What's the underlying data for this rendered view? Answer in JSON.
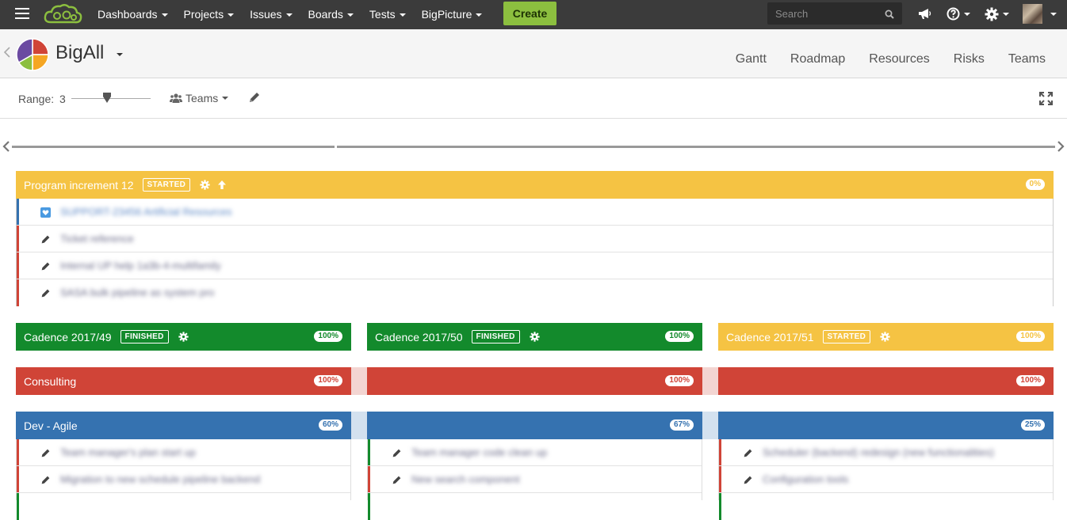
{
  "topnav": {
    "menus": [
      "Dashboards",
      "Projects",
      "Issues",
      "Boards",
      "Tests",
      "BigPicture"
    ],
    "create_label": "Create",
    "search_placeholder": "Search"
  },
  "project": {
    "name": "BigAll",
    "tabs": [
      "Gantt",
      "Roadmap",
      "Resources",
      "Risks",
      "Teams"
    ]
  },
  "toolbar": {
    "range_label": "Range:",
    "range_value": "3",
    "range_level": 0.45,
    "teams_label": "Teams"
  },
  "program_increment": {
    "title": "Program increment 12",
    "status": "STARTED",
    "percent": "0%",
    "color": "#f5c343",
    "issues": [
      {
        "text": "SUPPORT-23456 Artificial Resources",
        "bar_color": "#3572b0",
        "icon": "heart-issue-icon"
      },
      {
        "text": "Ticket reference",
        "bar_color": "#d04437",
        "icon": "pencil-icon"
      },
      {
        "text": "Internal UP help 1a3b-4-multifamily",
        "bar_color": "#d04437",
        "icon": "pencil-icon"
      },
      {
        "text": "SASA bulk pipeline as system pro",
        "bar_color": "#d04437",
        "icon": "pencil-icon"
      }
    ]
  },
  "cadences": [
    {
      "title": "Cadence 2017/49",
      "status": "FINISHED",
      "percent": "100%",
      "color": "#138a2c"
    },
    {
      "title": "Cadence 2017/50",
      "status": "FINISHED",
      "percent": "100%",
      "color": "#138a2c"
    },
    {
      "title": "Cadence 2017/51",
      "status": "STARTED",
      "percent": "100%",
      "color": "#f5c343"
    }
  ],
  "teams": [
    {
      "name": "Consulting",
      "color": "#d04437",
      "percents": [
        "100%",
        "100%",
        "100%"
      ]
    },
    {
      "name": "Dev - Agile",
      "color": "#3572b0",
      "percents": [
        "60%",
        "67%",
        "25%"
      ],
      "columns": [
        [
          {
            "text": "Team manager's plan start up",
            "bar_color": "#d04437"
          },
          {
            "text": "Migration to new schedule pipeline backend",
            "bar_color": "#d04437"
          }
        ],
        [
          {
            "text": "Team manager code clean up",
            "bar_color": "#138a2c"
          },
          {
            "text": "New search component",
            "bar_color": "#d04437"
          }
        ],
        [
          {
            "text": "Scheduler (backend) redesign (new functionalities)",
            "bar_color": "#d04437"
          },
          {
            "text": "Configuration tools",
            "bar_color": "#d04437"
          }
        ]
      ]
    }
  ]
}
